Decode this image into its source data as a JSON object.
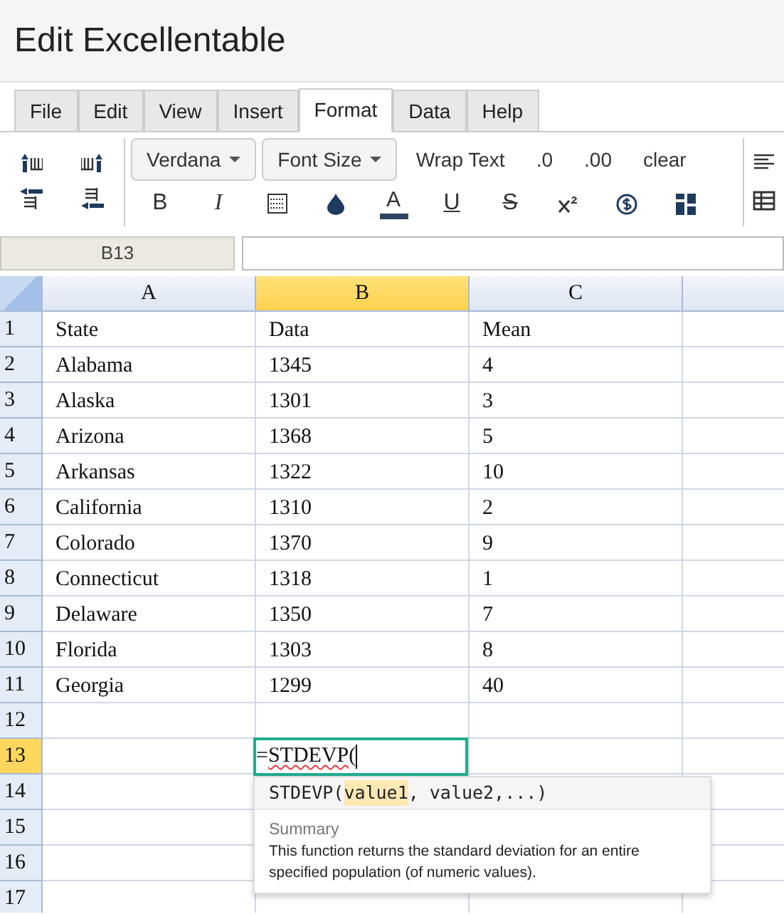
{
  "window": {
    "title": "Edit Excellentable"
  },
  "menu_tabs": [
    {
      "label": "File",
      "selected": false
    },
    {
      "label": "Edit",
      "selected": false
    },
    {
      "label": "View",
      "selected": false
    },
    {
      "label": "Insert",
      "selected": false
    },
    {
      "label": "Format",
      "selected": true
    },
    {
      "label": "Data",
      "selected": false
    },
    {
      "label": "Help",
      "selected": false
    }
  ],
  "toolbar": {
    "dropdowns": [
      "Verdana",
      "Font Size"
    ],
    "text_buttons": [
      "Wrap Text",
      ".0",
      ".00",
      "clear"
    ],
    "format_buttons": [
      {
        "kind": "bold",
        "label": "B"
      },
      {
        "kind": "italic",
        "label": "I"
      },
      {
        "kind": "borders"
      },
      {
        "kind": "fill"
      },
      {
        "kind": "text_color",
        "label": "A"
      },
      {
        "kind": "underline",
        "label": "U"
      },
      {
        "kind": "strike",
        "label": "S"
      },
      {
        "kind": "superscript"
      },
      {
        "kind": "currency"
      },
      {
        "kind": "merge"
      }
    ]
  },
  "name_box": "B13",
  "grid": {
    "columns": [
      {
        "label": "A",
        "selected": false
      },
      {
        "label": "B",
        "selected": true
      },
      {
        "label": "C",
        "selected": false
      },
      {
        "selected": false
      }
    ],
    "rows": [
      {
        "number": "1",
        "selected": false,
        "cells": [
          "State",
          "Data",
          "Mean"
        ]
      },
      {
        "number": "2",
        "selected": false,
        "cells": [
          "Alabama",
          "1345",
          "4"
        ]
      },
      {
        "number": "3",
        "selected": false,
        "cells": [
          "Alaska",
          "1301",
          "3"
        ]
      },
      {
        "number": "4",
        "selected": false,
        "cells": [
          "Arizona",
          "1368",
          "5"
        ]
      },
      {
        "number": "5",
        "selected": false,
        "cells": [
          "Arkansas",
          "1322",
          "10"
        ]
      },
      {
        "number": "6",
        "selected": false,
        "cells": [
          "California",
          "1310",
          "2"
        ]
      },
      {
        "number": "7",
        "selected": false,
        "cells": [
          "Colorado",
          "1370",
          "9"
        ]
      },
      {
        "number": "8",
        "selected": false,
        "cells": [
          "Connecticut",
          "1318",
          "1"
        ]
      },
      {
        "number": "9",
        "selected": false,
        "cells": [
          "Delaware",
          "1350",
          "7"
        ]
      },
      {
        "number": "10",
        "selected": false,
        "cells": [
          "Florida",
          "1303",
          "8"
        ]
      },
      {
        "number": "11",
        "selected": false,
        "cells": [
          "Georgia",
          "1299",
          "40"
        ]
      },
      {
        "number": "12",
        "selected": false
      },
      {
        "number": "13",
        "selected": true
      },
      {
        "number": "14",
        "selected": false
      },
      {
        "number": "15",
        "selected": false
      },
      {
        "number": "16",
        "selected": false
      },
      {
        "number": "17",
        "selected": false
      }
    ],
    "active_cell": {
      "equals": "=",
      "function": "STDEVP",
      "paren": "("
    }
  },
  "function_hint": {
    "name": "STDEVP(",
    "current_arg": "value1",
    "rest": ", value2,...)",
    "summary_label": "Summary",
    "description": "This function returns the standard deviation for an entire specified population (of numeric values)."
  }
}
